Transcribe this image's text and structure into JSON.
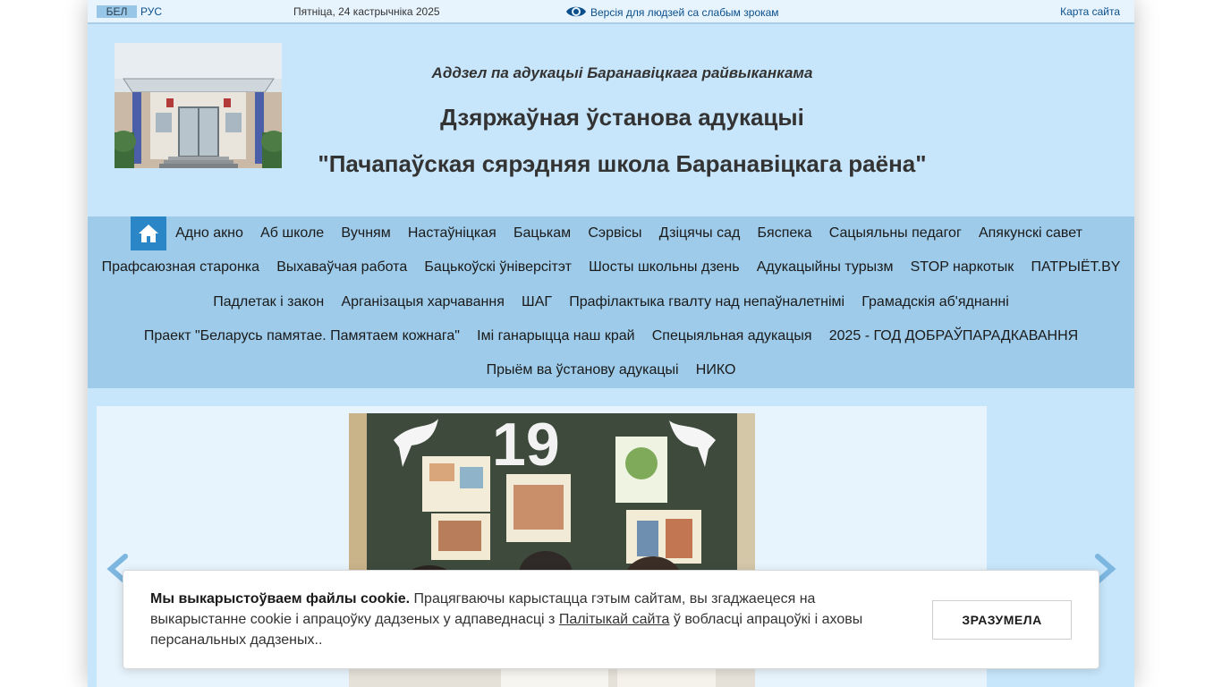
{
  "topbar": {
    "lang_bel": "БЕЛ",
    "lang_rus": "РУС",
    "date": "Пятніца, 24 кастрычніка 2025",
    "vision_link": "Версія для людзей са слабым зрокам",
    "sitemap": "Карта сайта"
  },
  "header": {
    "dept": "Аддзел па адукацыі Баранавіцкага райвыканкама",
    "institution": "Дзяржаўная ўстанова адукацыі",
    "school": "\"Пачапаўская сярэдняя школа Баранавіцкага раёна\""
  },
  "nav": {
    "rows": [
      [
        "Адно акно",
        "Аб школе",
        "Вучням",
        "Настаўніцкая",
        "Бацькам",
        "Сэрвісы",
        "Дзіцячы сад",
        "Бяспека",
        "Сацыяльны педагог",
        "Апякунскі савет"
      ],
      [
        "Прафсаюзная старонка",
        "Выхаваўчая работа",
        "Бацькоўскі ўніверсітэт",
        "Шосты школьны дзень",
        "Адукацыйны турызм",
        "STOP наркотык",
        "ПАТРЫЁТ.BY"
      ],
      [
        "Падлетак і закон",
        "Арганізацыя харчавання",
        "ШАГ",
        "Прафілактыка гвалту над непаўналетнімі",
        "Грамадскія аб'яднанні"
      ],
      [
        "Праект \"Беларусь памятае. Памятаем кожнага\"",
        "Імі ганарыцца наш край",
        "Спецыяльная адукацыя",
        "2025 - ГОД ДОБРАЎПАРАДКАВАННЯ"
      ],
      [
        "Прыём ва ўстанову адукацыі",
        "НИКО"
      ]
    ]
  },
  "slider": {
    "board_text": "19"
  },
  "cookie": {
    "bold": "Мы выкарыстоўваем файлы cookie.",
    "text_before_link": " Працягваючы карыстацца гэтым сайтам, вы згаджаецеся на выкарыстанне cookie і апрацоўку дадзеных у адпаведнасці з ",
    "link": "Палітыкай сайта",
    "text_after_link": " ў вобласці апрацоўкі і аховы персанальных дадзеных..",
    "button": "ЗРАЗУМЕЛА"
  },
  "colors": {
    "page_bg": "#c8e6fb",
    "nav_bg": "#9dcbe9",
    "home_btn": "#2a86c7",
    "link": "#0a4f8c"
  }
}
